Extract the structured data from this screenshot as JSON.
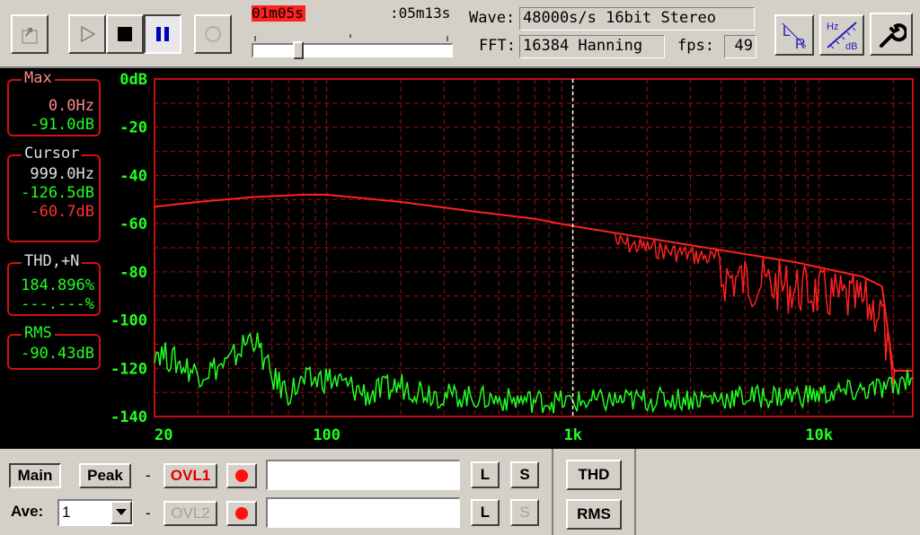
{
  "toolbar": {
    "elapsed": "01m05s",
    "total": ":05m13s",
    "wave_label": "Wave:",
    "wave_value": "48000s/s 16bit Stereo",
    "fft_label": "FFT:",
    "fft_value": "16384 Hanning",
    "fps_label": "fps:",
    "fps_value": "49",
    "position_fraction": 0.21,
    "icons": [
      "export-icon",
      "play-icon",
      "stop-icon",
      "pause-icon",
      "loop-icon",
      "lr-icon",
      "hz-db-icon",
      "wrench-icon"
    ],
    "lr_label_l": "L",
    "lr_label_r": "R",
    "hzdb_hz": "Hz",
    "hzdb_db": "dB"
  },
  "side": {
    "max": {
      "title": "Max",
      "freq": "0.0Hz",
      "level": "-91.0dB"
    },
    "cursor": {
      "title": "Cursor",
      "freq": "999.0Hz",
      "level_green": "-126.5dB",
      "level_red": "-60.7dB"
    },
    "thd": {
      "title": "THD,+N",
      "green": "184.896%",
      "red": "---.---%"
    },
    "rms": {
      "title": "RMS",
      "value": "-90.43dB"
    }
  },
  "chart_data": {
    "type": "line",
    "x_scale": "log",
    "xlim": [
      20,
      24000
    ],
    "ylim": [
      -140,
      0
    ],
    "ylabel": "dB",
    "y_ticks": [
      "0dB",
      "-20",
      "-40",
      "-60",
      "-80",
      "-100",
      "-120",
      "-140"
    ],
    "x_ticks": [
      "20",
      "100",
      "1k",
      "10k"
    ],
    "cursor_x": 999,
    "grid": true,
    "series": [
      {
        "color": "#ff2020",
        "x": [
          20,
          30,
          50,
          80,
          100,
          200,
          400,
          700,
          1000,
          2000,
          4000,
          8000,
          15000,
          18000,
          20000,
          24000
        ],
        "y": [
          -53,
          -51,
          -49,
          -48,
          -48,
          -51,
          -55,
          -58,
          -61,
          -66,
          -71,
          -76,
          -82,
          -86,
          -121,
          -121
        ]
      },
      {
        "color": "#20ff20",
        "x": [
          20,
          25,
          30,
          40,
          50,
          60,
          70,
          80,
          100,
          150,
          200,
          300,
          500,
          1000,
          2000,
          5000,
          10000,
          20000,
          24000
        ],
        "y": [
          -112,
          -118,
          -122,
          -118,
          -106,
          -124,
          -130,
          -126,
          -124,
          -131,
          -127,
          -131,
          -133,
          -134,
          -133,
          -132,
          -131,
          -128,
          -122
        ]
      }
    ]
  },
  "bottom": {
    "main_label": "Main",
    "peak_label": "Peak",
    "dash": "-",
    "ovl1_label": "OVL1",
    "ovl2_label": "OVL2",
    "l_label": "L",
    "s_label": "S",
    "thd_label": "THD",
    "rms_label": "RMS",
    "ave_label": "Ave:",
    "ave_value": "1"
  }
}
